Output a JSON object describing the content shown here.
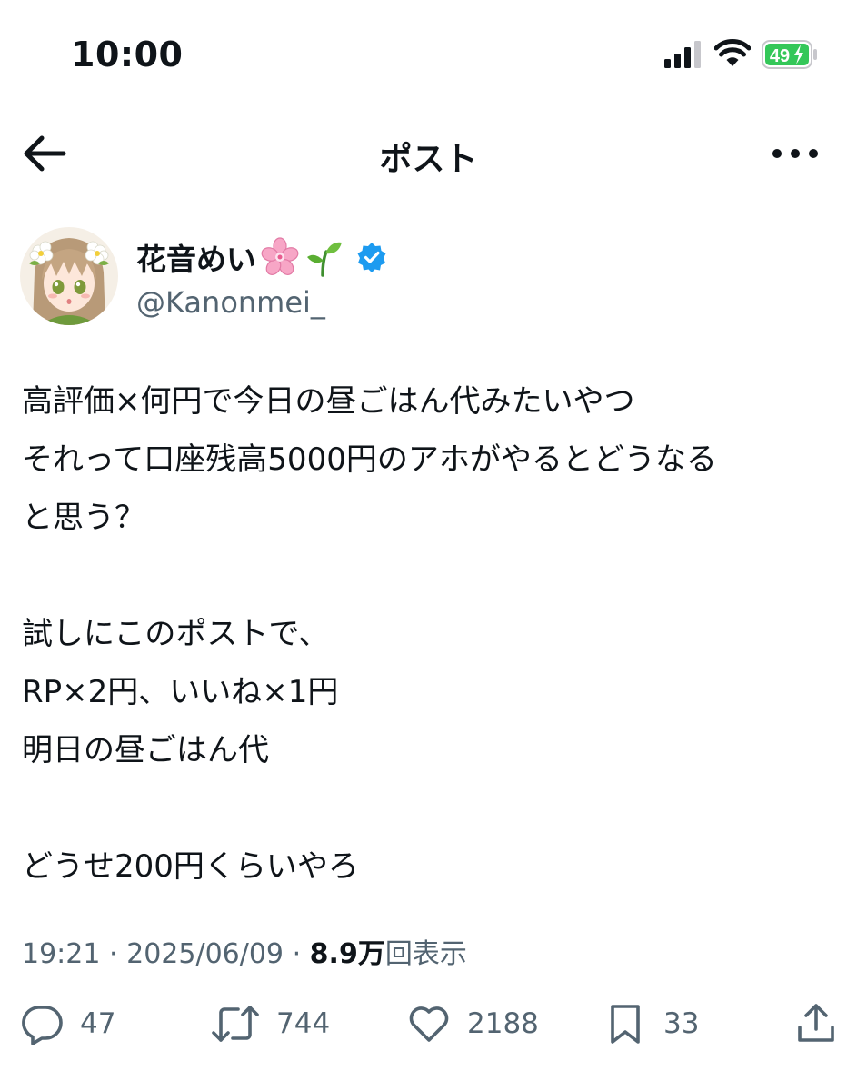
{
  "status_bar": {
    "time": "10:00",
    "battery_level": "49",
    "battery_fraction": 0.49,
    "battery_color": "#34c759"
  },
  "header": {
    "title": "ポスト",
    "back_icon": "arrow-left-icon",
    "more_icon": "more-horizontal-icon"
  },
  "author": {
    "display_name": "花音めい",
    "name_emojis": [
      "cherry-blossom-emoji",
      "seedling-emoji"
    ],
    "handle": "@Kanonmei_",
    "verified": true,
    "verified_color": "#1d9bf0"
  },
  "post": {
    "lines": [
      "高評価×何円で今日の昼ごはん代みたいやつ",
      "それって口座残高5000円のアホがやるとどうなる",
      "と思う？",
      "",
      "試しにこのポストで、",
      "RP×2円、いいね×1円",
      "明日の昼ごはん代",
      "",
      "どうせ200円くらいやろ"
    ]
  },
  "meta": {
    "time": "19:21",
    "separator": "·",
    "date": "2025/06/09",
    "views_count": "8.9万",
    "views_label": "回表示"
  },
  "actions": {
    "replies": "47",
    "reposts": "744",
    "likes": "2188",
    "bookmarks": "33"
  },
  "colors": {
    "text": "#0f1419",
    "secondary_text": "#536471",
    "accent": "#1d9bf0"
  }
}
